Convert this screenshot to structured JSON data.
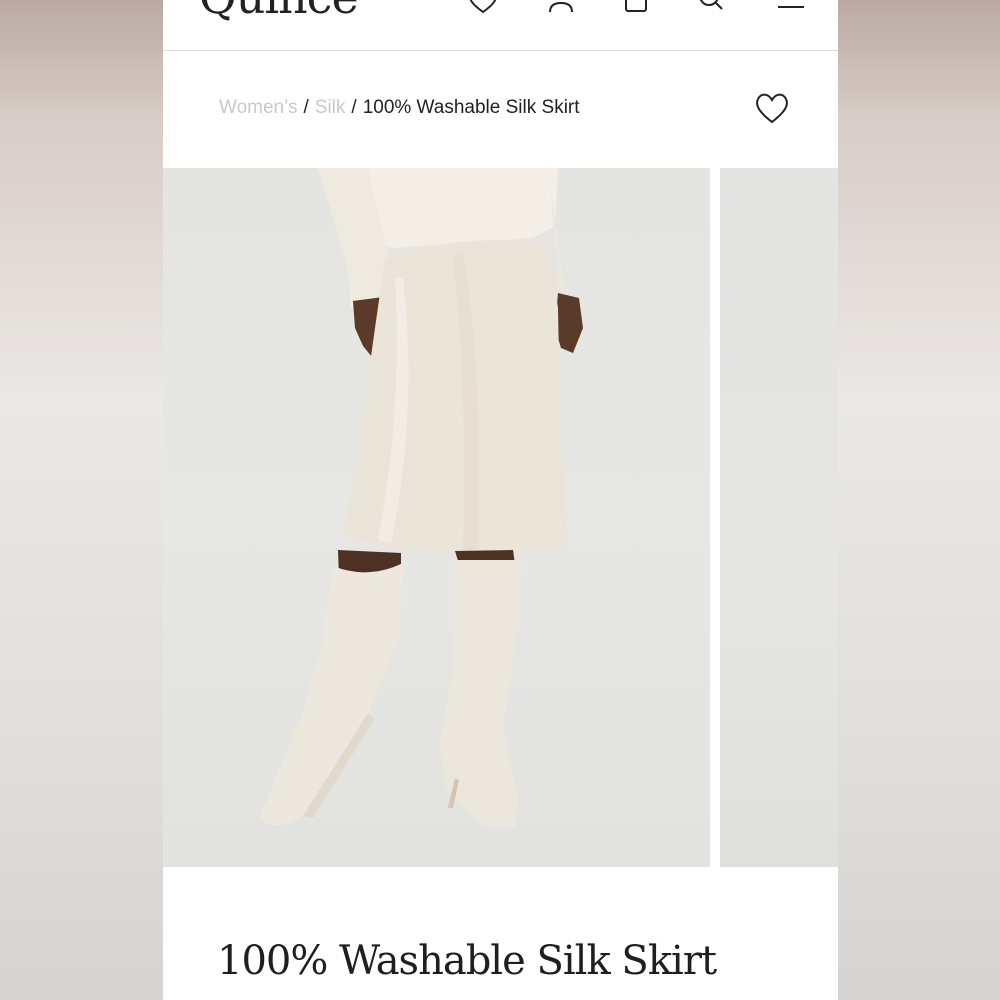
{
  "header": {
    "logo": "Quince",
    "icons": [
      "heart-icon",
      "account-icon",
      "bag-icon",
      "search-icon",
      "menu-icon"
    ]
  },
  "breadcrumb": {
    "items": [
      "Women’s",
      "Silk"
    ],
    "current": "100% Washable Silk Skirt",
    "separator": "/"
  },
  "product": {
    "title": "100% Washable Silk Skirt"
  },
  "colors": {
    "accent_text": "#222222",
    "breadcrumb_link": "#c9c9c9",
    "skirt": "#ece6da",
    "boots": "#ede9de"
  }
}
